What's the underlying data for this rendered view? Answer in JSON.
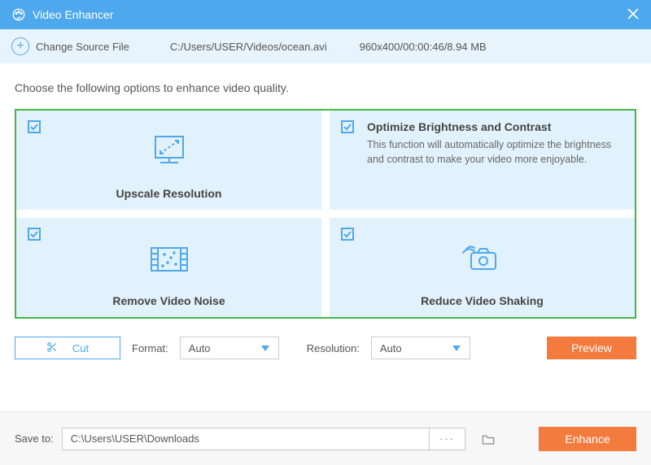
{
  "titlebar": {
    "title": "Video Enhancer"
  },
  "sourcebar": {
    "change_label": "Change Source File",
    "filepath": "C:/Users/USER/Videos/ocean.avi",
    "fileinfo": "960x400/00:00:46/8.94 MB"
  },
  "instruction": "Choose the following options to enhance video quality.",
  "options": {
    "upscale": {
      "title": "Upscale Resolution"
    },
    "brightness": {
      "title": "Optimize Brightness and Contrast",
      "desc": "This function will automatically optimize the brightness and contrast to make your video more enjoyable."
    },
    "noise": {
      "title": "Remove Video Noise"
    },
    "shaking": {
      "title": "Reduce Video Shaking"
    }
  },
  "controls": {
    "cut_label": "Cut",
    "format_label": "Format:",
    "format_value": "Auto",
    "resolution_label": "Resolution:",
    "resolution_value": "Auto",
    "preview_label": "Preview"
  },
  "footer": {
    "save_label": "Save to:",
    "save_path": "C:\\Users\\USER\\Downloads",
    "browse_label": "···",
    "enhance_label": "Enhance"
  }
}
